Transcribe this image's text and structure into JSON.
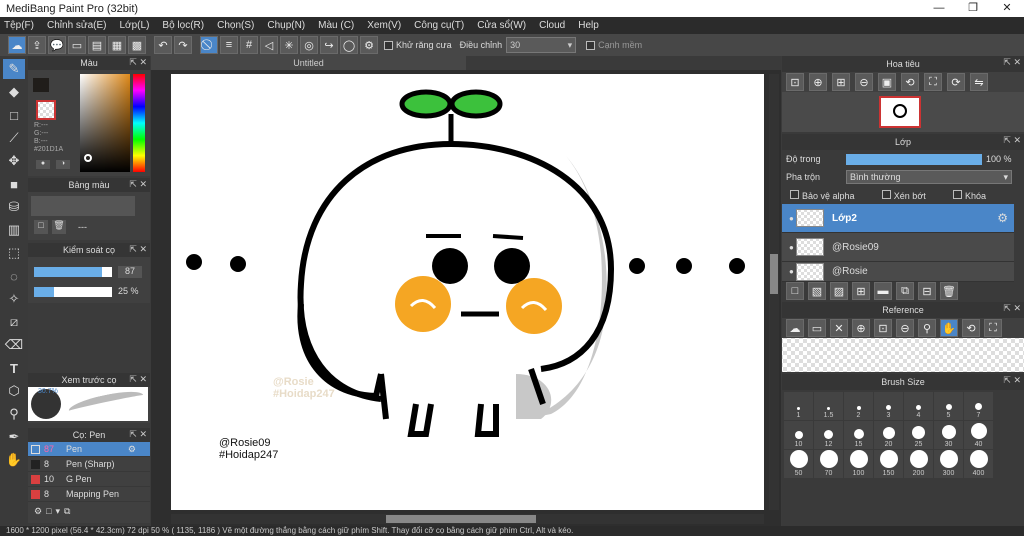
{
  "app": {
    "title": "MediBang Paint Pro (32bit)",
    "min": "—",
    "max": "❐",
    "close": "✕"
  },
  "menu": [
    "Tệp(F)",
    "Chỉnh sửa(E)",
    "Lớp(L)",
    "Bộ lọc(R)",
    "Chọn(S)",
    "Chụp(N)",
    "Màu (C)",
    "Xem(V)",
    "Công cụ(T)",
    "Cửa sổ(W)",
    "Cloud",
    "Help"
  ],
  "toolbar": {
    "antialias_label": "Khử răng cưa",
    "adjust_label": "Điều chỉnh",
    "adjust_value": "30",
    "edge_label": "Cạnh mềm"
  },
  "color_panel": {
    "title": "Màu",
    "r": "R:---",
    "g": "G:---",
    "b": "B:---",
    "hex": "#201D1A"
  },
  "palette_panel": {
    "title": "Bảng màu",
    "dash": "---"
  },
  "brush_control": {
    "title": "Kiểm soát cọ",
    "size": "87",
    "opacity": "25 %",
    "size_fraction": 0.87,
    "opacity_fraction": 0.25
  },
  "brush_preview": {
    "title": "Xem trước cọ",
    "size": "30.7%"
  },
  "brush_list": {
    "title": "Cọ: Pen",
    "items": [
      {
        "size": "87",
        "name": "Pen",
        "color": "#4a86c8"
      },
      {
        "size": "8",
        "name": "Pen (Sharp)",
        "color": "#222222"
      },
      {
        "size": "10",
        "name": "G Pen",
        "color": "#d94040"
      },
      {
        "size": "8",
        "name": "Mapping Pen",
        "color": "#d94040"
      }
    ]
  },
  "canvas": {
    "tab": "Untitled",
    "watermark1": "@Rosie",
    "watermark2": "#Hoidap247",
    "sig1": "@Rosie09",
    "sig2": "#Hoidap247"
  },
  "navigator": {
    "title": "Hoa tiêu"
  },
  "layer_panel": {
    "title": "Lớp",
    "opacity_label": "Độ trong",
    "opacity_value": "100 %",
    "blend_label": "Pha trộn",
    "blend_value": "Bình thường",
    "protect_alpha": "Bảo vệ alpha",
    "clipping": "Xén bớt",
    "lock": "Khóa",
    "layers": [
      {
        "name": "Lớp2"
      },
      {
        "name": "@Rosie09"
      },
      {
        "name": "@Rosie"
      }
    ]
  },
  "reference_panel": {
    "title": "Reference"
  },
  "brush_size_panel": {
    "title": "Brush Size",
    "sizes": [
      "1",
      "1.5",
      "2",
      "3",
      "4",
      "5",
      "7",
      "10",
      "12",
      "15",
      "20",
      "25",
      "30",
      "40",
      "50",
      "70",
      "100",
      "150",
      "200",
      "300",
      "400"
    ]
  },
  "status": {
    "text": "1600 * 1200 pixel   (56.4 * 42.3cm)   72 dpi   50 %   ( 1135, 1186 )   Vẽ một đường thẳng bằng cách giữ phím Shift. Thay đổi cỡ cọ bằng cách giữ phím Ctrl, Alt và kéo."
  }
}
